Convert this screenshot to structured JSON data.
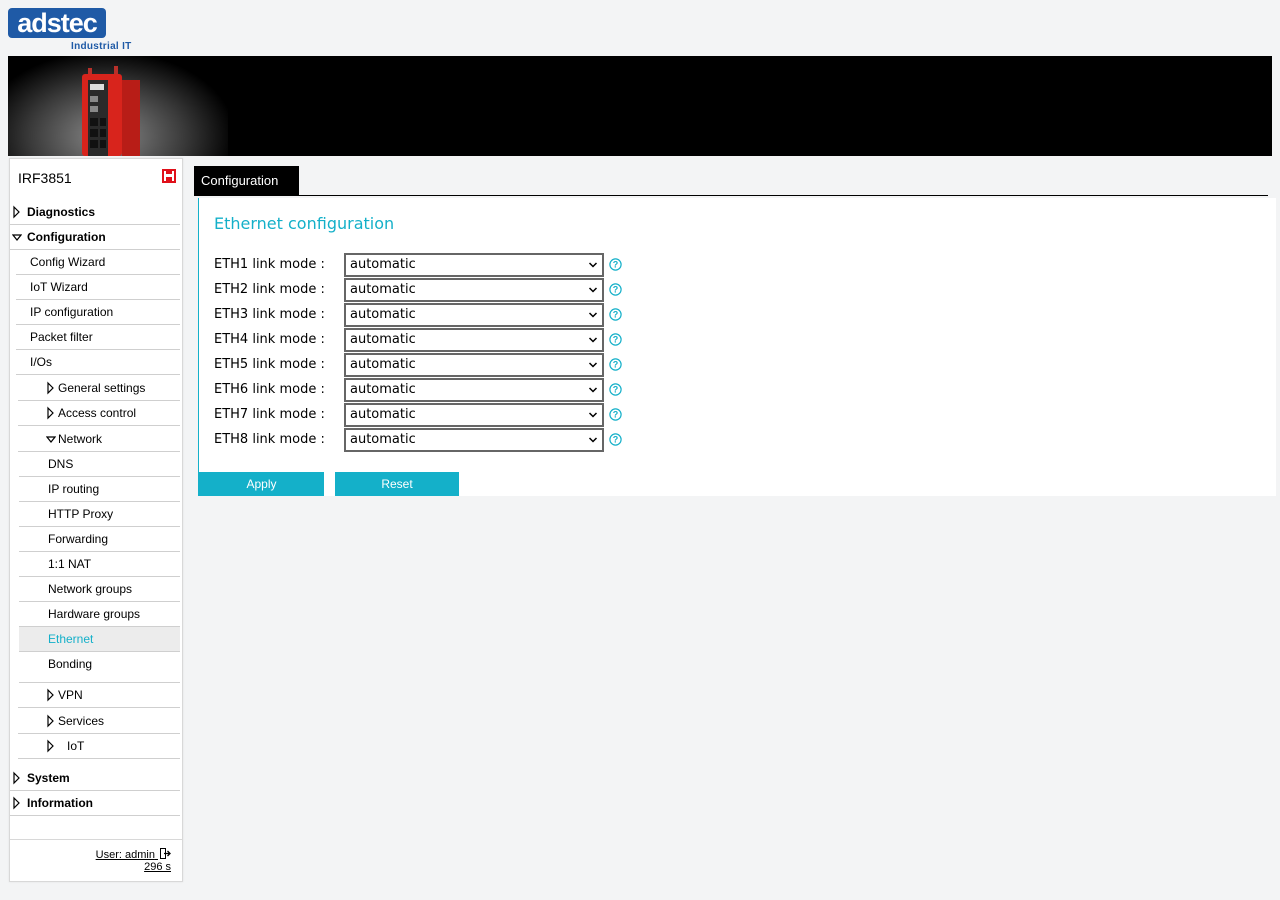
{
  "logo": {
    "word": "adstec",
    "subtitle": "Industrial IT"
  },
  "sidebar": {
    "device_name": "IRF3851",
    "items": [
      {
        "label": "Diagnostics"
      },
      {
        "label": "Configuration"
      },
      {
        "label": "Config Wizard"
      },
      {
        "label": "IoT Wizard"
      },
      {
        "label": "IP configuration"
      },
      {
        "label": "Packet filter"
      },
      {
        "label": "I/Os"
      },
      {
        "label": "General settings"
      },
      {
        "label": "Access control"
      },
      {
        "label": "Network"
      },
      {
        "label": "DNS"
      },
      {
        "label": "IP routing"
      },
      {
        "label": "HTTP Proxy"
      },
      {
        "label": "Forwarding"
      },
      {
        "label": "1:1 NAT"
      },
      {
        "label": "Network groups"
      },
      {
        "label": "Hardware groups"
      },
      {
        "label": "Ethernet",
        "active": true
      },
      {
        "label": "Bonding"
      },
      {
        "label": "VPN"
      },
      {
        "label": "Services"
      },
      {
        "label": "IoT"
      },
      {
        "label": "System"
      },
      {
        "label": "Information"
      }
    ],
    "user": "User: admin",
    "timer": "296 s"
  },
  "tabs": [
    {
      "label": "Configuration"
    }
  ],
  "main": {
    "title": "Ethernet configuration",
    "fields": [
      {
        "label": "ETH1 link mode :",
        "value": "automatic"
      },
      {
        "label": "ETH2 link mode :",
        "value": "automatic"
      },
      {
        "label": "ETH3 link mode :",
        "value": "automatic"
      },
      {
        "label": "ETH4 link mode :",
        "value": "automatic"
      },
      {
        "label": "ETH5 link mode :",
        "value": "automatic"
      },
      {
        "label": "ETH6 link mode :",
        "value": "automatic"
      },
      {
        "label": "ETH7 link mode :",
        "value": "automatic"
      },
      {
        "label": "ETH8 link mode :",
        "value": "automatic"
      }
    ],
    "apply_label": "Apply",
    "reset_label": "Reset"
  },
  "colors": {
    "accent": "#14b0c9",
    "brand": "#1f5aa6",
    "save_icon": "#e0101a"
  }
}
